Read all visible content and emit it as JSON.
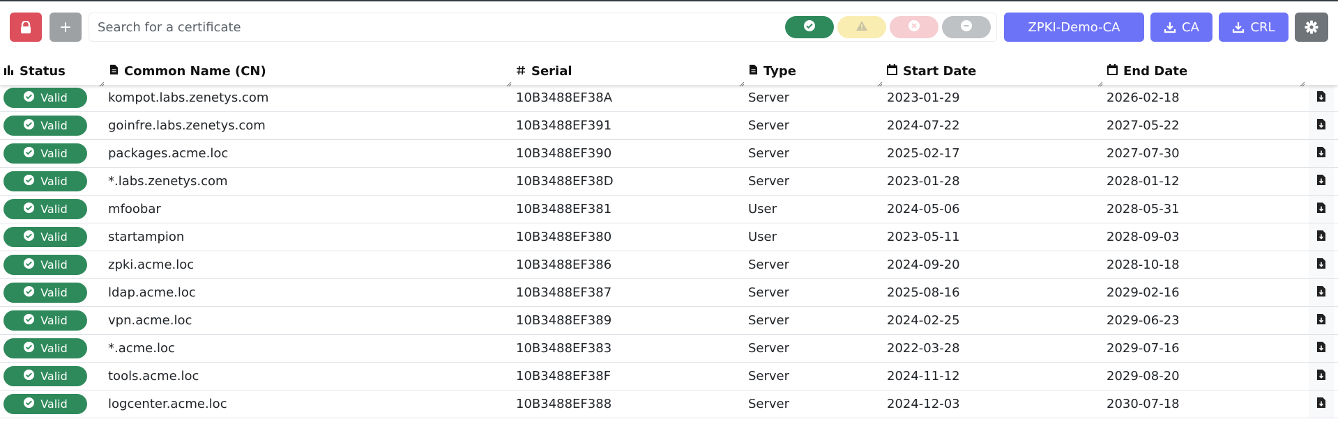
{
  "toolbar": {
    "lock_icon": "lock-icon",
    "add_icon": "plus-icon",
    "search_placeholder": "Search for a certificate",
    "search_value": "",
    "filters": [
      {
        "name": "valid",
        "icon": "check-circle-icon",
        "color": "#2f8a5b"
      },
      {
        "name": "warning",
        "icon": "warning-triangle-icon",
        "color": "#faedb2"
      },
      {
        "name": "revoked",
        "icon": "x-circle-icon",
        "color": "#f6cdd1"
      },
      {
        "name": "expired",
        "icon": "minus-circle-icon",
        "color": "#bfc2c4"
      }
    ],
    "ca_name": "ZPKI-Demo-CA",
    "ca_download_label": "CA",
    "crl_download_label": "CRL",
    "accent_color": "#6d73f7"
  },
  "table": {
    "columns": {
      "status": "Status",
      "cn": "Common Name (CN)",
      "serial": "Serial",
      "type": "Type",
      "start": "Start Date",
      "end": "End Date"
    },
    "status_color": "#2f8a5b",
    "rows": [
      {
        "status": "Valid",
        "cn": "kompot.labs.zenetys.com",
        "serial": "10B3488EF38A",
        "type": "Server",
        "start": "2023-01-29",
        "end": "2026-02-18"
      },
      {
        "status": "Valid",
        "cn": "goinfre.labs.zenetys.com",
        "serial": "10B3488EF391",
        "type": "Server",
        "start": "2024-07-22",
        "end": "2027-05-22"
      },
      {
        "status": "Valid",
        "cn": "packages.acme.loc",
        "serial": "10B3488EF390",
        "type": "Server",
        "start": "2025-02-17",
        "end": "2027-07-30"
      },
      {
        "status": "Valid",
        "cn": "*.labs.zenetys.com",
        "serial": "10B3488EF38D",
        "type": "Server",
        "start": "2023-01-28",
        "end": "2028-01-12"
      },
      {
        "status": "Valid",
        "cn": "mfoobar",
        "serial": "10B3488EF381",
        "type": "User",
        "start": "2024-05-06",
        "end": "2028-05-31"
      },
      {
        "status": "Valid",
        "cn": "startampion",
        "serial": "10B3488EF380",
        "type": "User",
        "start": "2023-05-11",
        "end": "2028-09-03"
      },
      {
        "status": "Valid",
        "cn": "zpki.acme.loc",
        "serial": "10B3488EF386",
        "type": "Server",
        "start": "2024-09-20",
        "end": "2028-10-18"
      },
      {
        "status": "Valid",
        "cn": "ldap.acme.loc",
        "serial": "10B3488EF387",
        "type": "Server",
        "start": "2025-08-16",
        "end": "2029-02-16"
      },
      {
        "status": "Valid",
        "cn": "vpn.acme.loc",
        "serial": "10B3488EF389",
        "type": "Server",
        "start": "2024-02-25",
        "end": "2029-06-23"
      },
      {
        "status": "Valid",
        "cn": "*.acme.loc",
        "serial": "10B3488EF383",
        "type": "Server",
        "start": "2022-03-28",
        "end": "2029-07-16"
      },
      {
        "status": "Valid",
        "cn": "tools.acme.loc",
        "serial": "10B3488EF38F",
        "type": "Server",
        "start": "2024-11-12",
        "end": "2029-08-20"
      },
      {
        "status": "Valid",
        "cn": "logcenter.acme.loc",
        "serial": "10B3488EF388",
        "type": "Server",
        "start": "2024-12-03",
        "end": "2030-07-18"
      }
    ]
  }
}
